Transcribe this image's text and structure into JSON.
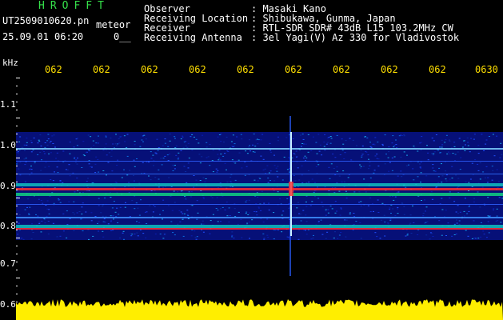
{
  "header": {
    "title": "HROFFT",
    "filename": "UT2509010620.pn",
    "meteor_label": "meteor",
    "datetime": "25.09.01 06:20",
    "flag": "0__"
  },
  "info": [
    {
      "label": "Observer",
      "value": ": Masaki Kano"
    },
    {
      "label": "Receiving Location",
      "value": ": Shibukawa, Gunma, Japan"
    },
    {
      "label": "Receiver",
      "value": ": RTL-SDR SDR# 43dB L15 103.2MHz CW"
    },
    {
      "label": "Receiving Antenna",
      "value": ": 3el Yagi(V) Az 330 for Vladivostok"
    }
  ],
  "axis": {
    "unit": "kHz",
    "y_ticks": [
      "1.1",
      "1.0",
      "0.9",
      "0.8",
      "0.7",
      "0.6"
    ],
    "x_ticks": [
      "062",
      "062",
      "062",
      "062",
      "062",
      "062",
      "062",
      "062",
      "062",
      "0630"
    ]
  },
  "colors": {
    "background": "#000000",
    "title": "#35e04a",
    "text": "#ffffff",
    "x_ticks": "#ffdf00",
    "signal_band": "#ff3030",
    "amplitude_bar": "#ffee00"
  }
}
